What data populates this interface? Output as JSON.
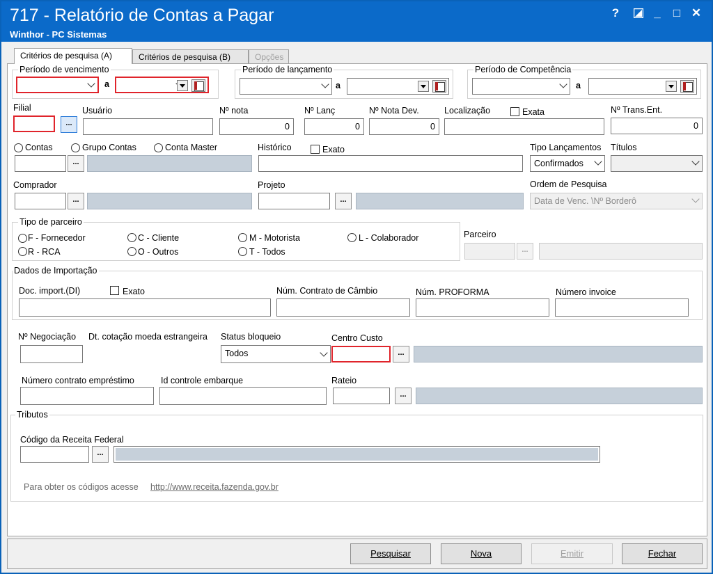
{
  "window": {
    "title": "717 - Relatório de Contas a Pagar",
    "subtitle": "Winthor - PC Sistemas",
    "controls": {
      "help": "?",
      "minimize": "_",
      "maximize": "□",
      "close": "✕"
    }
  },
  "tabs": [
    {
      "label": "Critérios de pesquisa (A)",
      "state": "active"
    },
    {
      "label": "Critérios de pesquisa (B)",
      "state": "normal"
    },
    {
      "label": "Opções",
      "state": "disabled"
    }
  ],
  "periods": {
    "vencimento": {
      "label": "Período de vencimento",
      "sep": "a"
    },
    "lancamento": {
      "label": "Período de lançamento",
      "sep": "a"
    },
    "competencia": {
      "label": "Período de Competência",
      "sep": "a"
    }
  },
  "fields": {
    "filial": {
      "label": "Filial",
      "btn": "..."
    },
    "usuario": {
      "label": "Usuário"
    },
    "num_nota": {
      "label": "Nº nota",
      "value": "0"
    },
    "num_lanc": {
      "label": "Nº Lanç",
      "value": "0"
    },
    "num_nota_dev": {
      "label": "Nº Nota Dev.",
      "value": "0"
    },
    "localizacao": {
      "label": "Localização",
      "exata_label": "Exata"
    },
    "num_trans_ent": {
      "label": "Nº Trans.Ent.",
      "value": "0"
    }
  },
  "contas": {
    "options": [
      "Contas",
      "Grupo Contas",
      "Conta Master"
    ],
    "btn": "..."
  },
  "historico": {
    "label": "Histórico",
    "exato_label": "Exato"
  },
  "tipo_lancamentos": {
    "label": "Tipo Lançamentos",
    "value": "Confirmados"
  },
  "titulos": {
    "label": "Títulos",
    "value": ""
  },
  "comprador": {
    "label": "Comprador",
    "btn": "..."
  },
  "projeto": {
    "label": "Projeto",
    "btn": "..."
  },
  "ordem_pesquisa": {
    "label": "Ordem de Pesquisa",
    "value": "Data de Venc. \\Nº Borderô"
  },
  "tipo_parceiro": {
    "label": "Tipo de parceiro",
    "options": [
      "F - Fornecedor",
      "C - Cliente",
      "M - Motorista",
      "L - Colaborador",
      "R - RCA",
      "O - Outros",
      "T - Todos"
    ]
  },
  "parceiro": {
    "label": "Parceiro",
    "btn": "..."
  },
  "importacao": {
    "label": "Dados de Importação",
    "doc_import": "Doc. import.(DI)",
    "exato_label": "Exato",
    "num_contrato_cambio": "Núm. Contrato de Câmbio",
    "num_proforma": "Núm. PROFORMA",
    "numero_invoice": "Número invoice"
  },
  "negociacao": {
    "label": "Nº Negociação"
  },
  "dt_cotacao": {
    "label": "Dt. cotação moeda estrangeira"
  },
  "status_bloqueio": {
    "label": "Status bloqueio",
    "value": "Todos"
  },
  "centro_custo": {
    "label": "Centro Custo",
    "btn": "..."
  },
  "numero_contrato_emprestimo": {
    "label": "Número contrato empréstimo"
  },
  "id_controle_embarque": {
    "label": "Id controle embarque"
  },
  "rateio": {
    "label": "Rateio",
    "btn": "..."
  },
  "tributos": {
    "label": "Tributos",
    "codigo_label": "Código da Receita Federal",
    "btn": "...",
    "hint": "Para obter os códigos acesse",
    "link": "http://www.receita.fazenda.gov.br"
  },
  "buttons": {
    "pesquisar": "Pesquisar",
    "nova": "Nova",
    "emitir": "Emitir",
    "fechar": "Fechar"
  },
  "colors": {
    "titlebar": "#0b6ac9",
    "required_border": "#e0242b",
    "readonly_fill": "#c6d0da"
  }
}
